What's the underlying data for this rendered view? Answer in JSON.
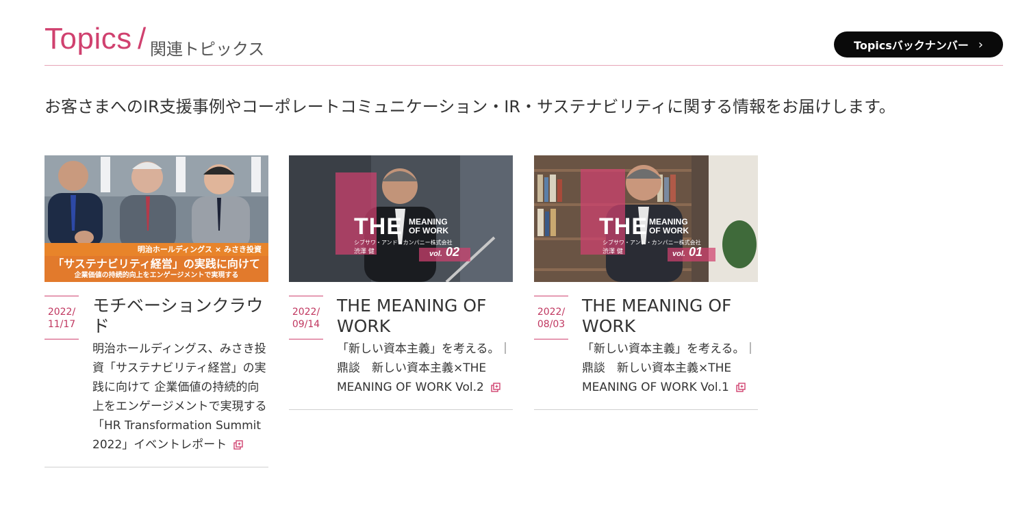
{
  "header": {
    "title_en": "Topics",
    "title_slash": "/",
    "title_ja": "関連トピックス",
    "backnumber_label": "Topicsバックナンバー",
    "accent_color": "#d0416f"
  },
  "lead": "お客さまへのIR支援事例やコーポレートコミュニケーション・IR・サステナビリティに関する情報をお届けします。",
  "cards": [
    {
      "date_line1": "2022/",
      "date_line2": "11/17",
      "title": "モチベーションクラウド",
      "description": "明治ホールディングス、みさき投資「サステナビリティ経営」の実践に向けて 企業価値の持続的向上をエンゲージメントで実現する「HR Transformation Summit 2022」イベントレポート",
      "thumb": {
        "band_label": "明治ホールディングス × みさき投資",
        "headline": "「サステナビリティ経営」の実践に向けて",
        "subline": "企業価値の持続的向上をエンゲージメントで実現する"
      }
    },
    {
      "date_line1": "2022/",
      "date_line2": "09/14",
      "title": "THE MEANING OF WORK",
      "description": "「新しい資本主義」を考える。｜鼎談　新しい資本主義×THE MEANING OF WORK Vol.2",
      "thumb": {
        "the": "THE",
        "meaning": "MEANING",
        "of_work": "OF WORK",
        "vol_prefix": "vol.",
        "vol_num": "02",
        "company": "シブサワ・アンド・カンパニー株式会社",
        "person": "渋澤 健"
      }
    },
    {
      "date_line1": "2022/",
      "date_line2": "08/03",
      "title": "THE MEANING OF WORK",
      "description": "「新しい資本主義」を考える。｜鼎談　新しい資本主義×THE MEANING OF WORK Vol.1",
      "thumb": {
        "the": "THE",
        "meaning": "MEANING",
        "of_work": "OF WORK",
        "vol_prefix": "vol.",
        "vol_num": "01",
        "company": "シブサワ・アンド・カンパニー株式会社",
        "person": "渋澤 健"
      }
    }
  ]
}
